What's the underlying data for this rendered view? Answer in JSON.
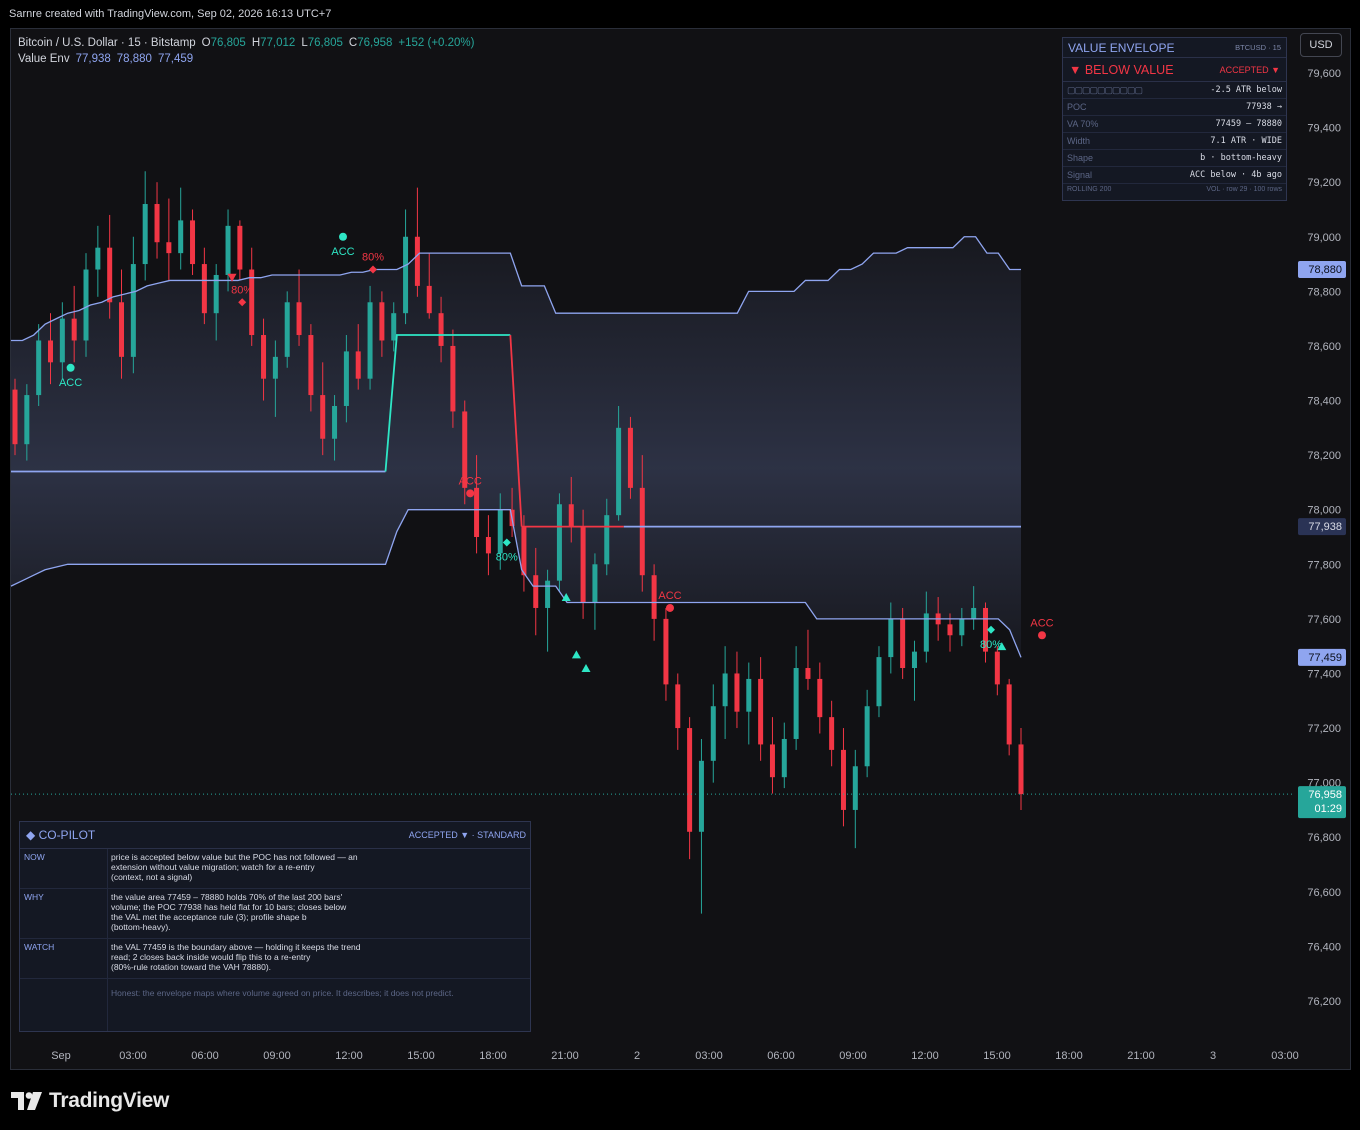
{
  "header": {
    "credit": "Sarnre created with TradingView.com, Sep 02, 2026 16:13 UTC+7"
  },
  "legend": {
    "symbol": "Bitcoin / U.S. Dollar · 15 · Bitstamp",
    "o_label": "O",
    "o": "76,805",
    "h_label": "H",
    "h": "77,012",
    "l_label": "L",
    "l": "76,805",
    "c_label": "C",
    "c": "76,958",
    "change": "+152 (+0.20%)",
    "indicator": "Value Env",
    "env_poc": "77,938",
    "env_vah": "78,880",
    "env_val": "77,459"
  },
  "currency": "USD",
  "value_envelope": {
    "title": "VALUE ENVELOPE",
    "sub": "BTCUSD · 15",
    "bias": "▼ BELOW VALUE",
    "state": "ACCEPTED ▼",
    "meter": "▢▢▢▢▢▢▢▢▢▢",
    "meter_value": "-2.5 ATR below",
    "rows": [
      {
        "k": "POC",
        "v": "77938  →"
      },
      {
        "k": "VA 70%",
        "v": "77459 – 78880"
      },
      {
        "k": "Width",
        "v": "7.1 ATR · WIDE"
      },
      {
        "k": "Shape",
        "v": "b · bottom-heavy"
      },
      {
        "k": "Signal",
        "v": "ACC below · 4b ago"
      }
    ],
    "foot_left": "ROLLING 200",
    "foot_right": "VOL · row 29 · 100 rows"
  },
  "copilot": {
    "title": "◆ CO-PILOT",
    "status": "ACCEPTED ▼  · STANDARD",
    "rows": [
      {
        "k": "NOW",
        "v": "price is accepted below value but the POC has not followed — an\nextension without value migration; watch for a re-entry\n(context, not a signal)"
      },
      {
        "k": "WHY",
        "v": "the value area 77459 – 78880 holds 70% of the last 200 bars'\nvolume; the POC 77938 has held flat for 10 bars; closes below\nthe VAL met the acceptance rule (3); profile shape b\n(bottom-heavy)."
      },
      {
        "k": "WATCH",
        "v": "the VAL 77459 is the boundary above — holding it keeps the trend\nread; 2 closes back inside would flip this to a re-entry\n(80%-rule rotation toward the VAH 78880)."
      },
      {
        "k": "",
        "v": "Honest: the envelope maps where volume agreed on price. It describes; it does not predict."
      }
    ]
  },
  "brand": "TradingView",
  "colors": {
    "up": "#26a69a",
    "down": "#f23645",
    "envelope": "#8fa5f0",
    "poc_accept": "#2ee6c5",
    "teal_marker": "#2ee6c5"
  },
  "chart_data": {
    "type": "candlestick",
    "y_axis": {
      "ylim": [
        76000,
        79800
      ],
      "ticks": [
        79600,
        79400,
        79200,
        79000,
        78800,
        78600,
        78400,
        78200,
        78000,
        77800,
        77600,
        77400,
        77200,
        77000,
        76800,
        76600,
        76400,
        76200
      ]
    },
    "x_axis": {
      "ticks": [
        {
          "label": "Sep",
          "t": 0
        },
        {
          "label": "03:00",
          "t": 12
        },
        {
          "label": "06:00",
          "t": 24
        },
        {
          "label": "09:00",
          "t": 36
        },
        {
          "label": "12:00",
          "t": 48
        },
        {
          "label": "15:00",
          "t": 60
        },
        {
          "label": "18:00",
          "t": 72
        },
        {
          "label": "21:00",
          "t": 84
        },
        {
          "label": "2",
          "t": 96
        },
        {
          "label": "03:00",
          "t": 108
        },
        {
          "label": "06:00",
          "t": 120
        },
        {
          "label": "09:00",
          "t": 132
        },
        {
          "label": "12:00",
          "t": 144
        },
        {
          "label": "15:00",
          "t": 156
        },
        {
          "label": "18:00",
          "t": 168
        },
        {
          "label": "21:00",
          "t": 180
        },
        {
          "label": "3",
          "t": 192
        },
        {
          "label": "03:00",
          "t": 204
        }
      ]
    },
    "price_labels": [
      {
        "text": "78,880",
        "value": 78880,
        "style": "env"
      },
      {
        "text": "77,938",
        "value": 77938,
        "style": "poc"
      },
      {
        "text": "77,459",
        "value": 77459,
        "style": "env"
      },
      {
        "text": "76,958",
        "value": 76958,
        "style": "last",
        "countdown": "01:29"
      }
    ],
    "last_price": 76958,
    "start_t": -8.3,
    "step_t": 0.25,
    "vah": [
      78620,
      78620,
      78640,
      78680,
      78700,
      78720,
      78730,
      78750,
      78760,
      78780,
      78790,
      78800,
      78820,
      78830,
      78840,
      78840,
      78840,
      78840,
      78840,
      78840,
      78840,
      78850,
      78850,
      78860,
      78860,
      78860,
      78860,
      78860,
      78860,
      78860,
      78870,
      78870,
      78880,
      78880,
      78880,
      78900,
      78940,
      78940,
      78940,
      78940,
      78940,
      78940,
      78940,
      78940,
      78940,
      78820,
      78820,
      78820,
      78720,
      78720,
      78720,
      78720,
      78720,
      78720,
      78720,
      78720,
      78720,
      78720,
      78720,
      78720,
      78720,
      78720,
      78720,
      78720,
      78720,
      78800,
      78800,
      78800,
      78800,
      78800,
      78840,
      78840,
      78840,
      78880,
      78880,
      78900,
      78940,
      78940,
      78940,
      78960,
      78960,
      78960,
      78960,
      78960,
      79000,
      79000,
      78940,
      78940,
      78880,
      78880
    ],
    "val": [
      77720,
      77740,
      77760,
      77780,
      77790,
      77800,
      77800,
      77800,
      77800,
      77800,
      77800,
      77800,
      77800,
      77800,
      77800,
      77800,
      77800,
      77800,
      77800,
      77800,
      77800,
      77800,
      77800,
      77800,
      77800,
      77800,
      77800,
      77800,
      77800,
      77800,
      77800,
      77800,
      77800,
      77800,
      77920,
      78000,
      78000,
      78000,
      78000,
      78000,
      78000,
      78000,
      78000,
      78000,
      78000,
      77780,
      77720,
      77720,
      77720,
      77660,
      77660,
      77660,
      77660,
      77660,
      77660,
      77660,
      77660,
      77660,
      77660,
      77660,
      77660,
      77660,
      77660,
      77660,
      77660,
      77660,
      77660,
      77660,
      77660,
      77660,
      77660,
      77600,
      77600,
      77600,
      77600,
      77600,
      77600,
      77600,
      77600,
      77600,
      77600,
      77600,
      77600,
      77600,
      77600,
      77600,
      77600,
      77600,
      77560,
      77459
    ],
    "poc": [
      78140,
      78140,
      78140,
      78140,
      78140,
      78140,
      78140,
      78140,
      78140,
      78140,
      78140,
      78140,
      78140,
      78140,
      78140,
      78140,
      78140,
      78140,
      78140,
      78140,
      78140,
      78140,
      78140,
      78140,
      78140,
      78140,
      78140,
      78140,
      78140,
      78140,
      78140,
      78140,
      78140,
      78140,
      78640,
      78640,
      78640,
      78640,
      78640,
      78640,
      78640,
      78640,
      78640,
      78640,
      78640,
      77938,
      77938,
      77938,
      77938,
      77938,
      77938,
      77938,
      77938,
      77938,
      77938,
      77938,
      77938,
      77938,
      77938,
      77938,
      77938,
      77938,
      77938,
      77938,
      77938,
      77938,
      77938,
      77938,
      77938,
      77938,
      77938,
      77938,
      77938,
      77938,
      77938,
      77938,
      77938,
      77938,
      77938,
      77938,
      77938,
      77938,
      77938,
      77938,
      77938,
      77938,
      77938,
      77938,
      77938,
      77938
    ],
    "candles": [
      [
        78440,
        78480,
        78200,
        78240
      ],
      [
        78240,
        78460,
        78180,
        78420
      ],
      [
        78420,
        78680,
        78380,
        78620
      ],
      [
        78620,
        78720,
        78460,
        78540
      ],
      [
        78540,
        78760,
        78480,
        78700
      ],
      [
        78700,
        78820,
        78540,
        78620
      ],
      [
        78620,
        78940,
        78560,
        78880
      ],
      [
        78880,
        79040,
        78780,
        78960
      ],
      [
        78960,
        79080,
        78700,
        78760
      ],
      [
        78760,
        78880,
        78480,
        78560
      ],
      [
        78560,
        79000,
        78500,
        78900
      ],
      [
        78900,
        79240,
        78840,
        79120
      ],
      [
        79120,
        79200,
        78920,
        78980
      ],
      [
        78980,
        79140,
        78840,
        78940
      ],
      [
        78940,
        79180,
        78880,
        79060
      ],
      [
        79060,
        79100,
        78860,
        78900
      ],
      [
        78900,
        78960,
        78680,
        78720
      ],
      [
        78720,
        78900,
        78620,
        78860
      ],
      [
        78860,
        79100,
        78800,
        79040
      ],
      [
        79040,
        79060,
        78840,
        78880
      ],
      [
        78880,
        78960,
        78600,
        78640
      ],
      [
        78640,
        78700,
        78400,
        78480
      ],
      [
        78480,
        78620,
        78340,
        78560
      ],
      [
        78560,
        78800,
        78520,
        78760
      ],
      [
        78760,
        78880,
        78600,
        78640
      ],
      [
        78640,
        78680,
        78360,
        78420
      ],
      [
        78420,
        78540,
        78200,
        78260
      ],
      [
        78260,
        78420,
        78180,
        78380
      ],
      [
        78380,
        78640,
        78320,
        78580
      ],
      [
        78580,
        78680,
        78440,
        78480
      ],
      [
        78480,
        78820,
        78440,
        78760
      ],
      [
        78760,
        78800,
        78560,
        78620
      ],
      [
        78620,
        78760,
        78580,
        78720
      ],
      [
        78720,
        79100,
        78680,
        79000
      ],
      [
        79000,
        79180,
        78780,
        78820
      ],
      [
        78820,
        78940,
        78700,
        78720
      ],
      [
        78720,
        78780,
        78540,
        78600
      ],
      [
        78600,
        78660,
        78300,
        78360
      ],
      [
        78360,
        78400,
        78020,
        78080
      ],
      [
        78080,
        78200,
        77840,
        77900
      ],
      [
        77900,
        77980,
        77760,
        77840
      ],
      [
        77840,
        78060,
        77780,
        78000
      ],
      [
        78000,
        78080,
        77900,
        77940
      ],
      [
        77940,
        77980,
        77700,
        77760
      ],
      [
        77760,
        77860,
        77540,
        77640
      ],
      [
        77640,
        77780,
        77480,
        77740
      ],
      [
        77740,
        78060,
        77700,
        78020
      ],
      [
        78020,
        78120,
        77880,
        77940
      ],
      [
        77940,
        78000,
        77600,
        77660
      ],
      [
        77660,
        77840,
        77560,
        77800
      ],
      [
        77800,
        78040,
        77760,
        77980
      ],
      [
        77980,
        78380,
        77960,
        78300
      ],
      [
        78300,
        78340,
        78040,
        78080
      ],
      [
        78080,
        78200,
        77700,
        77760
      ],
      [
        77760,
        77800,
        77520,
        77600
      ],
      [
        77600,
        77640,
        77300,
        77360
      ],
      [
        77360,
        77400,
        77120,
        77200
      ],
      [
        77200,
        77240,
        76720,
        76820
      ],
      [
        76820,
        77160,
        76520,
        77080
      ],
      [
        77080,
        77360,
        77000,
        77280
      ],
      [
        77280,
        77500,
        77160,
        77400
      ],
      [
        77400,
        77480,
        77200,
        77260
      ],
      [
        77260,
        77440,
        77140,
        77380
      ],
      [
        77380,
        77460,
        77080,
        77140
      ],
      [
        77140,
        77240,
        76960,
        77020
      ],
      [
        77020,
        77220,
        76980,
        77160
      ],
      [
        77160,
        77500,
        77120,
        77420
      ],
      [
        77420,
        77560,
        77340,
        77380
      ],
      [
        77380,
        77440,
        77180,
        77240
      ],
      [
        77240,
        77300,
        77060,
        77120
      ],
      [
        77120,
        77200,
        76840,
        76900
      ],
      [
        76900,
        77120,
        76760,
        77060
      ],
      [
        77060,
        77340,
        77020,
        77280
      ],
      [
        77280,
        77500,
        77240,
        77460
      ],
      [
        77460,
        77660,
        77400,
        77600
      ],
      [
        77600,
        77640,
        77380,
        77420
      ],
      [
        77420,
        77520,
        77300,
        77480
      ],
      [
        77480,
        77700,
        77440,
        77620
      ],
      [
        77620,
        77680,
        77520,
        77580
      ],
      [
        77580,
        77620,
        77480,
        77540
      ],
      [
        77540,
        77640,
        77500,
        77600
      ],
      [
        77600,
        77720,
        77560,
        77640
      ],
      [
        77640,
        77660,
        77440,
        77480
      ],
      [
        77480,
        77500,
        77320,
        77360
      ],
      [
        77360,
        77380,
        77100,
        77140
      ],
      [
        77140,
        77200,
        76900,
        76958
      ]
    ],
    "markers": [
      {
        "t": 1.6,
        "price": 78520,
        "type": "dot",
        "color": "#2ee6c5",
        "label": "ACC",
        "label_below": true
      },
      {
        "t": 28.5,
        "price": 78850,
        "type": "tri-down",
        "color": "#f23645"
      },
      {
        "t": 30.2,
        "price": 78760,
        "type": "diamond",
        "color": "#f23645",
        "label": "80%",
        "label_above": true
      },
      {
        "t": 47.0,
        "price": 79000,
        "type": "dot",
        "color": "#2ee6c5",
        "label": "ACC",
        "label_below": true
      },
      {
        "t": 52.0,
        "price": 78880,
        "type": "diamond",
        "color": "#f23645",
        "label": "80%",
        "label_above": true
      },
      {
        "t": 68.2,
        "price": 78060,
        "type": "dot",
        "color": "#f23645",
        "label": "ACC",
        "label_above": true
      },
      {
        "t": 74.3,
        "price": 77880,
        "type": "diamond",
        "color": "#2ee6c5",
        "label": "80%",
        "label_below": true
      },
      {
        "t": 84.2,
        "price": 77680,
        "type": "tri-up",
        "color": "#2ee6c5"
      },
      {
        "t": 85.9,
        "price": 77470,
        "type": "tri-up",
        "color": "#2ee6c5"
      },
      {
        "t": 87.5,
        "price": 77420,
        "type": "tri-up",
        "color": "#2ee6c5"
      },
      {
        "t": 101.5,
        "price": 77640,
        "type": "dot",
        "color": "#f23645",
        "label": "ACC",
        "label_above": true
      },
      {
        "t": 155.0,
        "price": 77560,
        "type": "diamond",
        "color": "#2ee6c5",
        "label": "80%",
        "label_below": true
      },
      {
        "t": 156.8,
        "price": 77500,
        "type": "tri-up",
        "color": "#2ee6c5"
      },
      {
        "t": 163.5,
        "price": 77540,
        "type": "dot",
        "color": "#f23645",
        "label": "ACC",
        "label_above": true
      }
    ]
  }
}
